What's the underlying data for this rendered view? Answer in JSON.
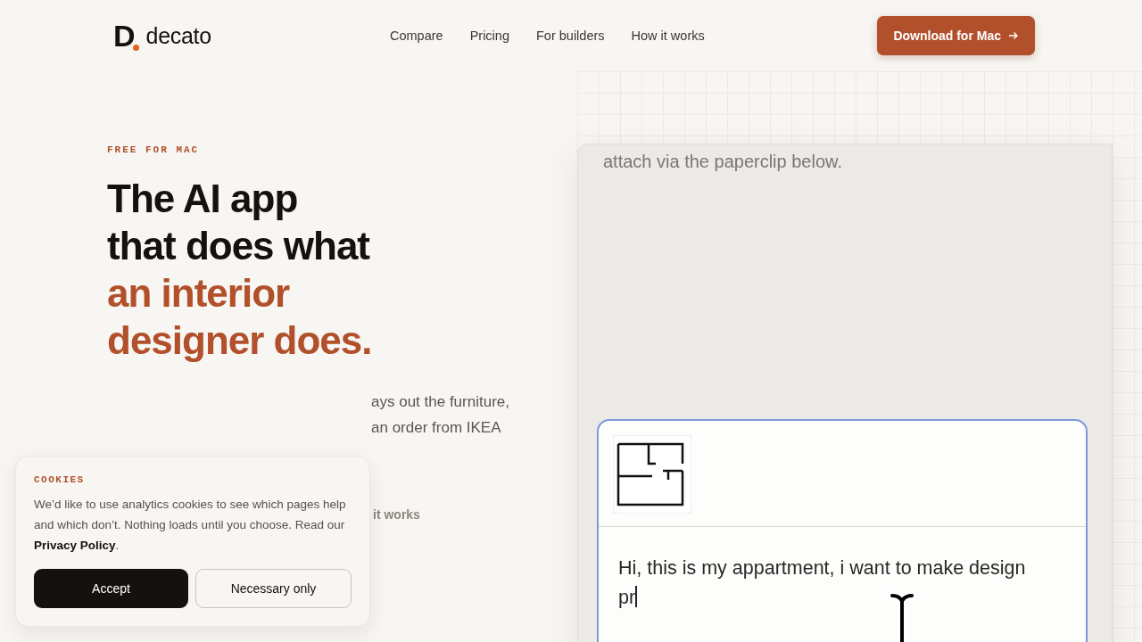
{
  "header": {
    "logo_mark": "D",
    "brand": "decato",
    "nav": [
      {
        "label": "Compare"
      },
      {
        "label": "Pricing"
      },
      {
        "label": "For builders"
      },
      {
        "label": "How it works"
      }
    ],
    "cta": "Download for Mac"
  },
  "hero": {
    "eyebrow": "FREE FOR MAC",
    "headline_dark": [
      "The AI app",
      "that does what"
    ],
    "headline_accent": [
      "an interior",
      "designer does."
    ],
    "body_lines": [
      "ays out the furniture,",
      "an order from IKEA"
    ],
    "secondary_link": "it works"
  },
  "app_preview": {
    "message": "attach via the paperclip below.",
    "composer": {
      "value": "Hi, this is my appartment, i want to make design pr"
    }
  },
  "cookie_banner": {
    "title": "COOKIES",
    "text": "We’d like to use analytics cookies to see which pages help and which don’t. Nothing loads until you choose. Read our",
    "link": "Privacy Policy",
    "after_link": ".",
    "buttons": [
      {
        "label": "Accept",
        "kind": "primary"
      },
      {
        "label": "Necessary only",
        "kind": "secondary"
      }
    ]
  }
}
